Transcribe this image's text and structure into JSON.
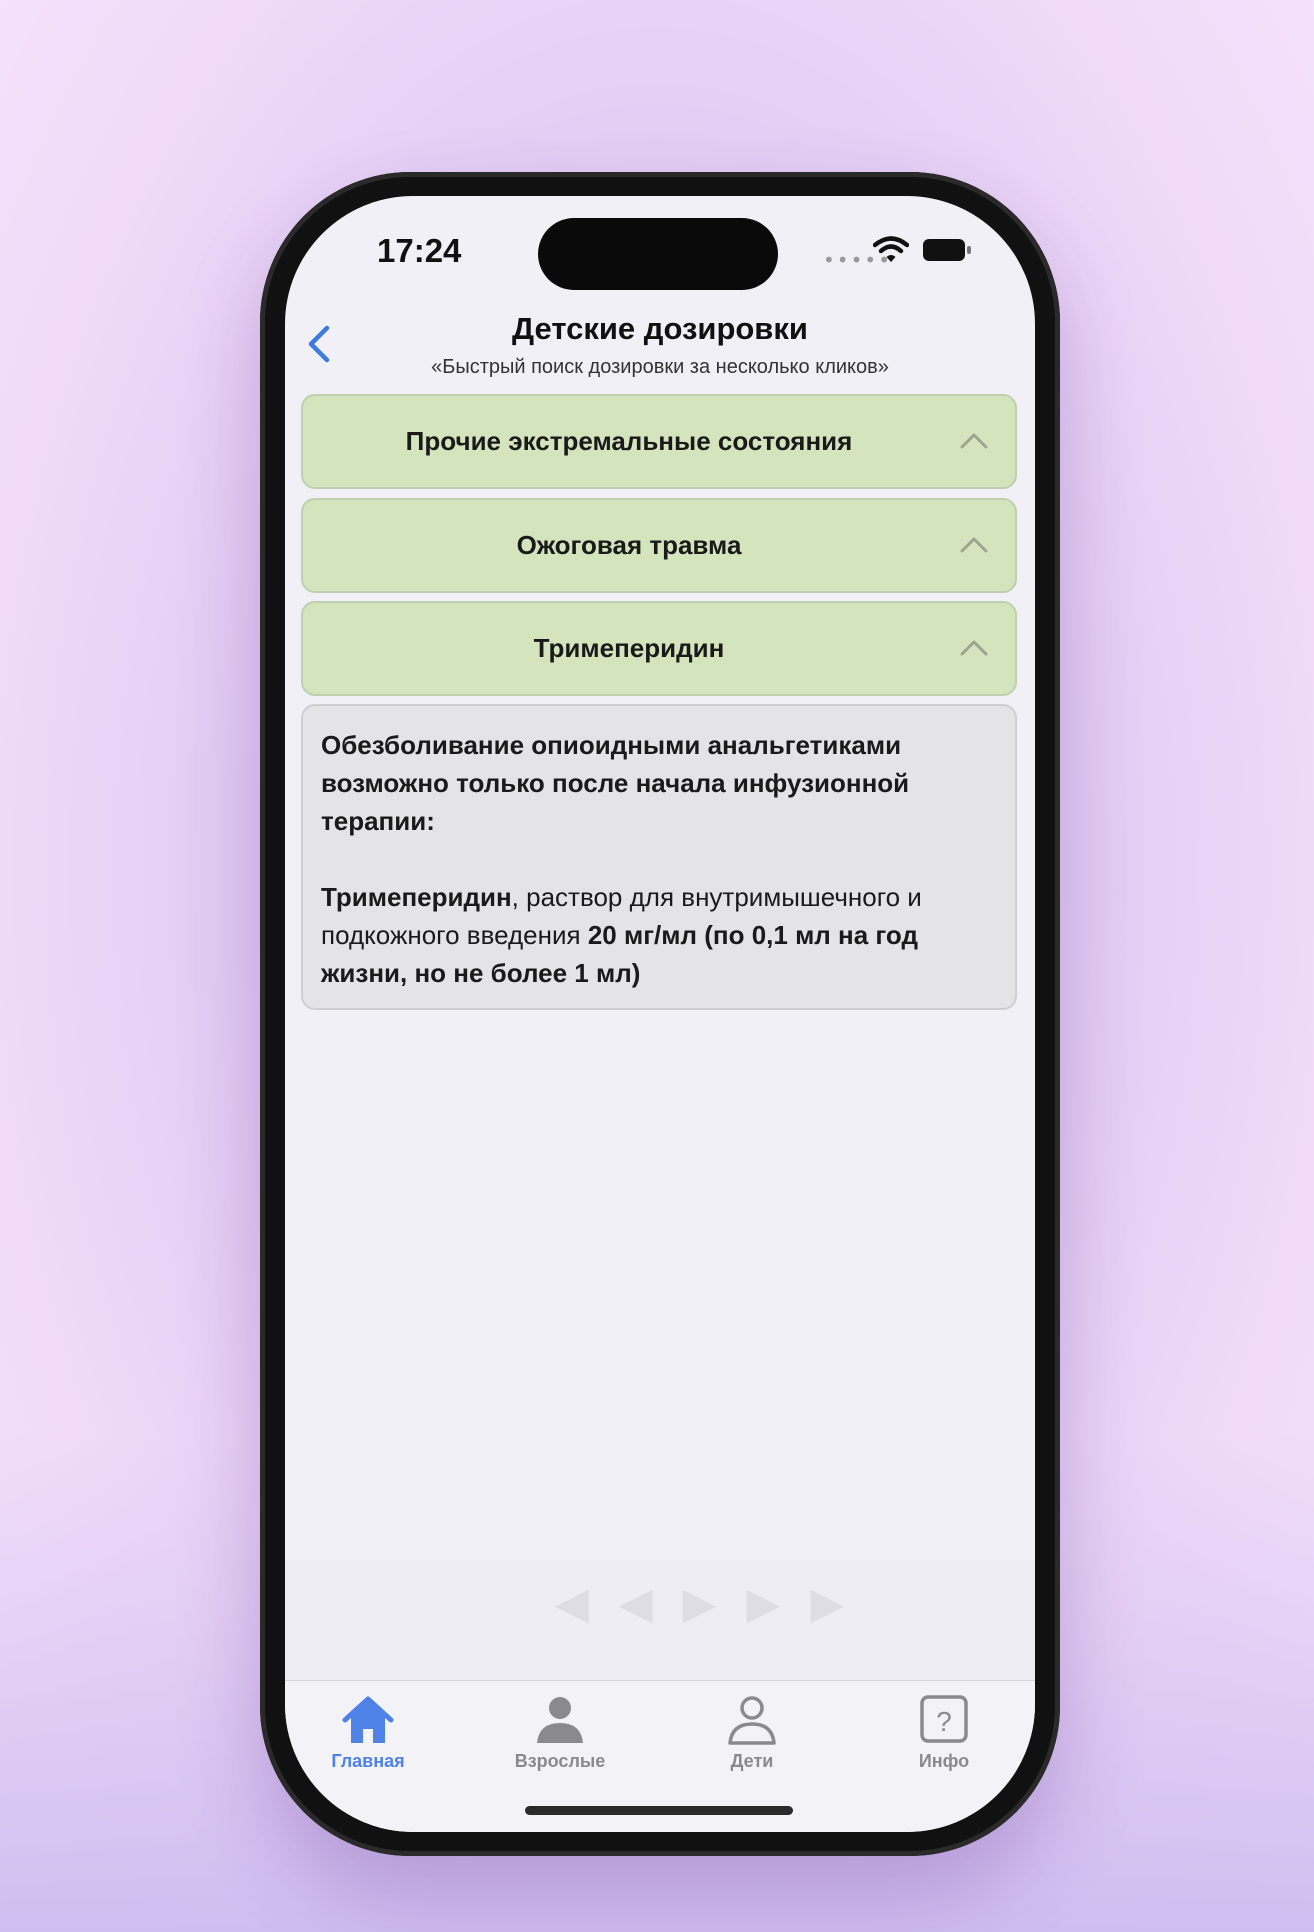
{
  "status_bar": {
    "time": "17:24",
    "signal_dots": "•••••"
  },
  "header": {
    "title": "Детские дозировки",
    "subtitle": "«Быстрый поиск дозировки за несколько кликов»"
  },
  "sections": [
    {
      "label": "Прочие экстремальные состояния",
      "expanded": true
    },
    {
      "label": "Ожоговая травма",
      "expanded": true
    },
    {
      "label": "Тримеперидин",
      "expanded": true
    }
  ],
  "content": {
    "intro": "Обезболивание опиоидными анальгетиками возможно только после начала инфузионной терапии:",
    "drug_name": "Тримеперидин",
    "drug_text": ", раствор для внутримышечного и подкожного введения ",
    "dose": "20 мг/мл (по 0,1 мл на год жизни, но не более 1 мл)"
  },
  "tabs": [
    {
      "label": "Главная",
      "icon": "house-icon",
      "active": true
    },
    {
      "label": "Взрослые",
      "icon": "person-fill-icon",
      "active": false
    },
    {
      "label": "Дети",
      "icon": "person-outline-icon",
      "active": false
    },
    {
      "label": "Инфо",
      "icon": "question-square-icon",
      "active": false
    }
  ],
  "colors": {
    "accent": "#4f82e6",
    "section_bg": "#d4e5be",
    "card_bg": "#e4e4e6",
    "inactive_tab": "#8a8a8e"
  }
}
